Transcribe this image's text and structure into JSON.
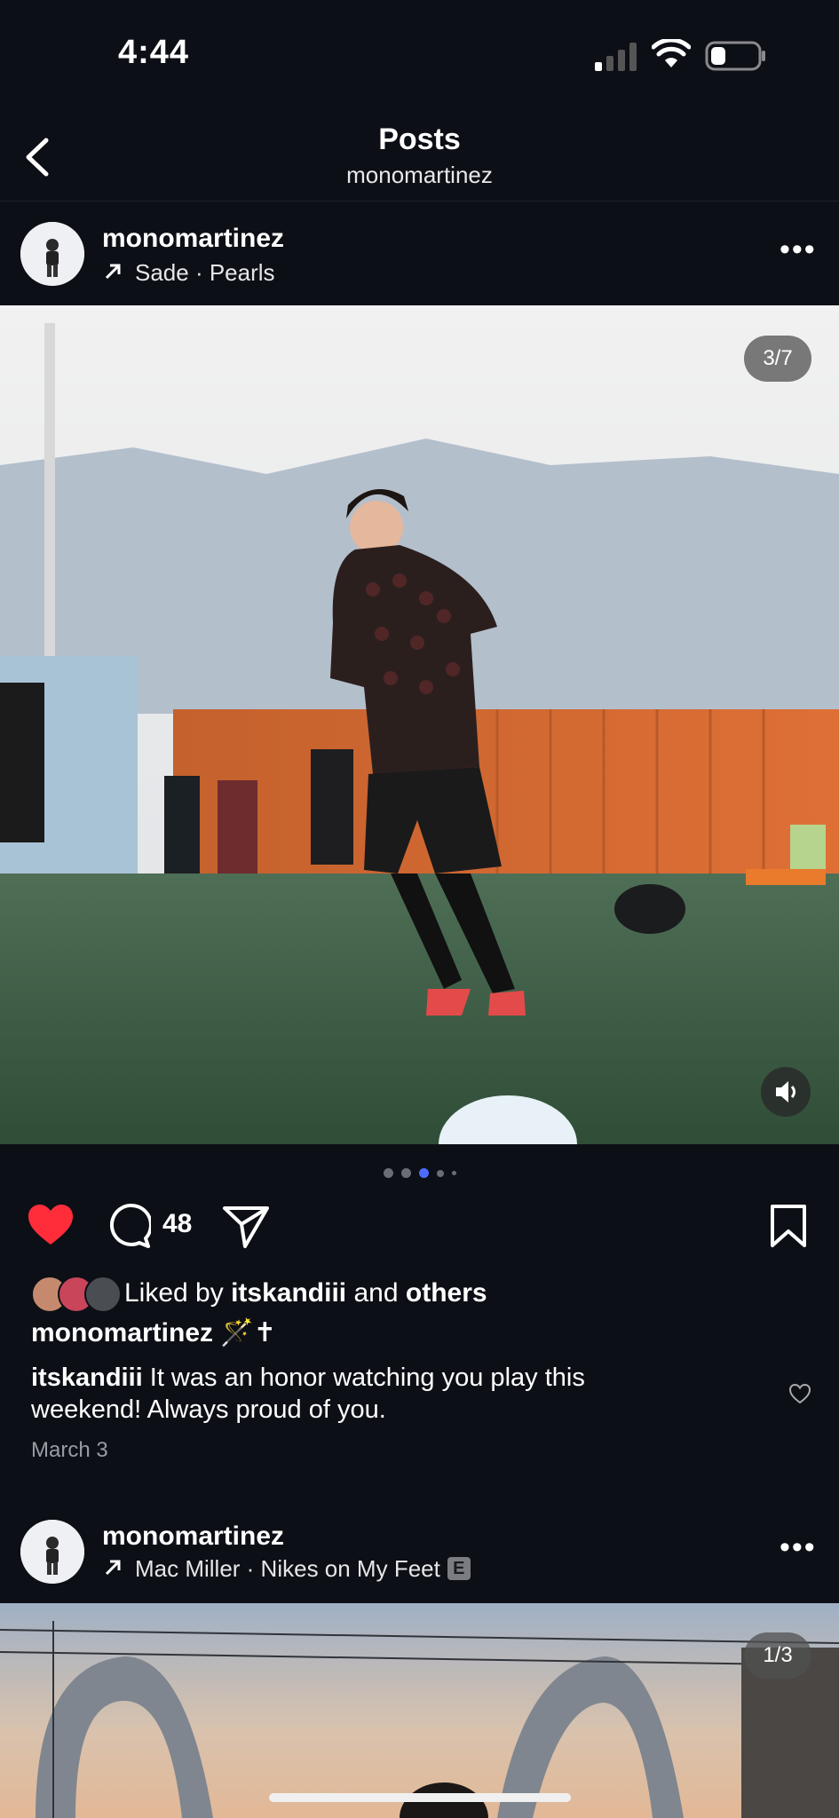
{
  "status": {
    "time": "4:44"
  },
  "nav": {
    "title": "Posts",
    "subtitle": "monomartinez"
  },
  "post1": {
    "username": "monomartinez",
    "music": "Sade · Pearls",
    "counter": "3/7",
    "comments_count": "48",
    "liked_by_prefix": "Liked by",
    "liked_by_user": "itskandiii",
    "liked_by_and": "and",
    "liked_by_others": "others",
    "caption_user": "monomartinez",
    "caption_text": "🪄✝",
    "comment_user": "itskandiii",
    "comment_text": "It was an honor watching you play this weekend! Always proud of you.",
    "date": "March 3"
  },
  "post2": {
    "username": "monomartinez",
    "music": "Mac Miller · Nikes on My Feet",
    "explicit_badge": "E",
    "counter": "1/3"
  },
  "colors": {
    "background": "#0d0f16",
    "like_red": "#ff2d3a",
    "active_dot": "#4e6bff"
  },
  "icons": [
    "back-chevron-icon",
    "arrow-up-right-icon",
    "more-icon",
    "heart-filled-icon",
    "comment-icon",
    "share-icon",
    "bookmark-icon",
    "volume-icon",
    "small-heart-icon"
  ]
}
